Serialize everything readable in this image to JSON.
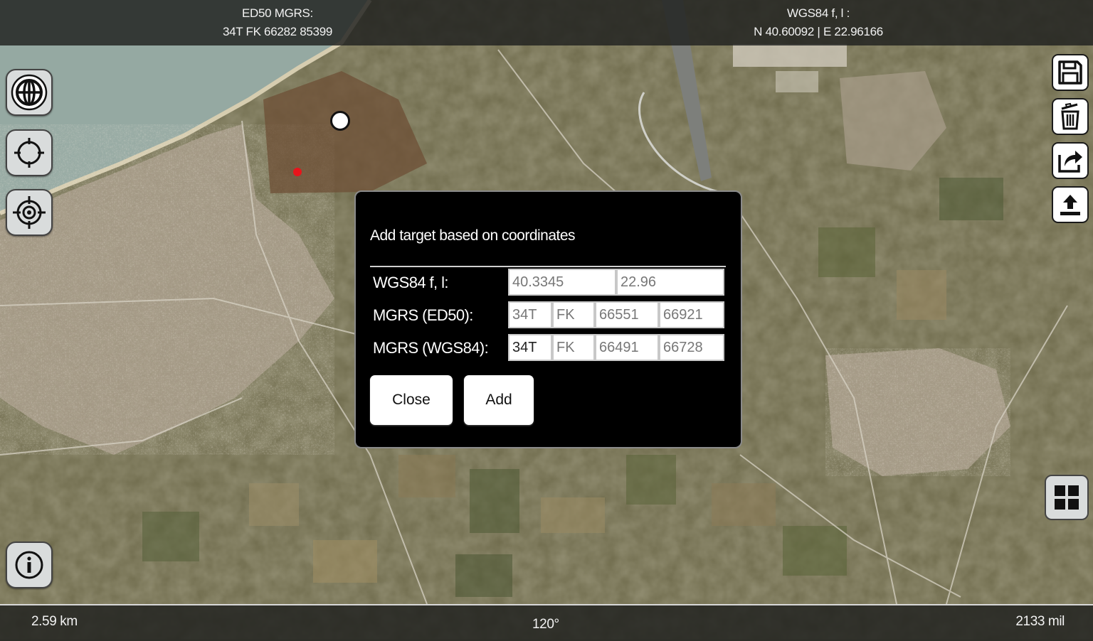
{
  "top_bar": {
    "left_title": "ED50 MGRS:",
    "left_value": "34T FK 66282 85399",
    "right_title": "WGS84 f, l :",
    "right_value": "N 40.60092 | E 22.96166"
  },
  "bottom_bar": {
    "scale": "2.59 km",
    "bearing": "120°",
    "mils": "2133 mil"
  },
  "dialog": {
    "title": "Add target based on coordinates",
    "rows": [
      {
        "label": "WGS84 f, l:",
        "fields": [
          "40.3345",
          "22.96"
        ]
      },
      {
        "label": "MGRS (ED50):",
        "fields": [
          "34T",
          "FK",
          "66551",
          "66921"
        ]
      },
      {
        "label": "MGRS (WGS84):",
        "fields": [
          "34T",
          "FK",
          "66491",
          "66728"
        ]
      }
    ],
    "close_label": "Close",
    "add_label": "Add"
  },
  "icons": {
    "left": [
      "globe-icon",
      "crosshair-circle-icon",
      "target-icon",
      "info-icon"
    ],
    "right": [
      "save-icon",
      "trash-icon",
      "share-icon",
      "upload-icon",
      "grid-icon"
    ]
  },
  "colors": {
    "bar_background": "#1e201e",
    "dialog_background": "#000000",
    "marker_red": "#e8141b",
    "button_background": "#ffffff"
  }
}
